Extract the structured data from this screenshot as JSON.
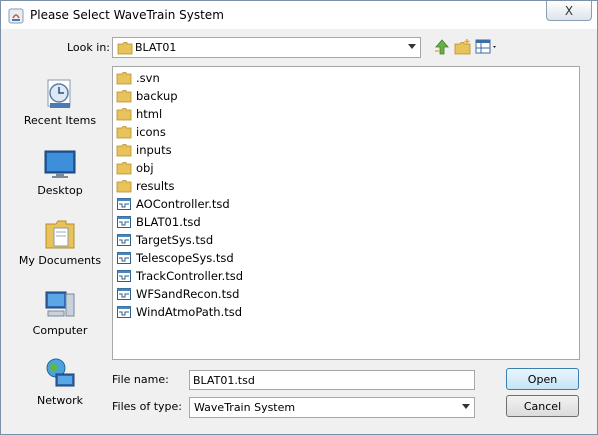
{
  "window": {
    "title": "Please Select WaveTrain System"
  },
  "look_in": {
    "label": "Look in:",
    "value": "BLAT01"
  },
  "places": [
    {
      "label": "Recent Items",
      "icon": "recent-items-icon"
    },
    {
      "label": "Desktop",
      "icon": "desktop-icon"
    },
    {
      "label": "My Documents",
      "icon": "my-documents-icon"
    },
    {
      "label": "Computer",
      "icon": "computer-icon"
    },
    {
      "label": "Network",
      "icon": "network-icon"
    }
  ],
  "files": [
    {
      "name": ".svn",
      "type": "folder"
    },
    {
      "name": "backup",
      "type": "folder"
    },
    {
      "name": "html",
      "type": "folder"
    },
    {
      "name": "icons",
      "type": "folder"
    },
    {
      "name": "inputs",
      "type": "folder"
    },
    {
      "name": "obj",
      "type": "folder"
    },
    {
      "name": "results",
      "type": "folder"
    },
    {
      "name": "AOController.tsd",
      "type": "file"
    },
    {
      "name": "BLAT01.tsd",
      "type": "file"
    },
    {
      "name": "TargetSys.tsd",
      "type": "file"
    },
    {
      "name": "TelescopeSys.tsd",
      "type": "file"
    },
    {
      "name": "TrackController.tsd",
      "type": "file"
    },
    {
      "name": "WFSandRecon.tsd",
      "type": "file"
    },
    {
      "name": "WindAtmoPath.tsd",
      "type": "file"
    }
  ],
  "file_name": {
    "label": "File name:",
    "value": "BLAT01.tsd"
  },
  "files_of_type": {
    "label": "Files of type:",
    "value": "WaveTrain System"
  },
  "buttons": {
    "open": "Open",
    "cancel": "Cancel",
    "close": "X"
  },
  "colors": {
    "folder": "#e8c25a",
    "accent": "#3c7fb1"
  }
}
